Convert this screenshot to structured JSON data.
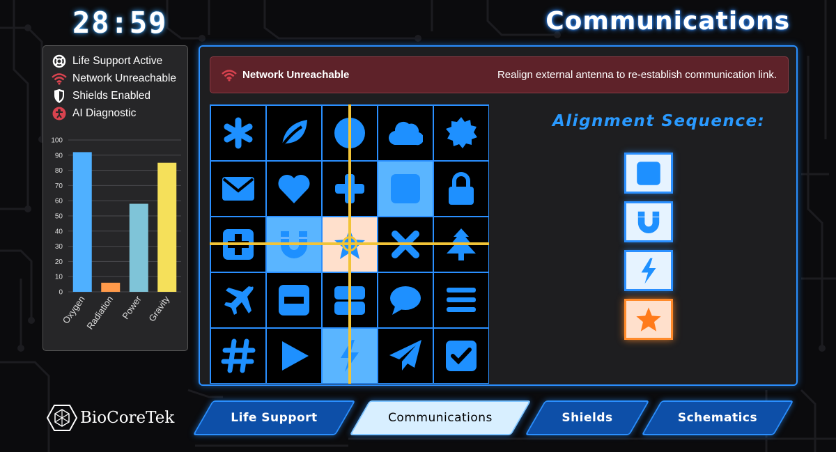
{
  "timer": "28:59",
  "page_title": "Communications",
  "status": {
    "items": [
      {
        "label": "Life Support Active",
        "icon": "life-ring-icon",
        "color": "#ffffff"
      },
      {
        "label": "Network Unreachable",
        "icon": "wifi-icon",
        "color": "#d9434f"
      },
      {
        "label": "Shields Enabled",
        "icon": "shield-icon",
        "color": "#ffffff"
      },
      {
        "label": "AI Diagnostic",
        "icon": "ai-person-icon",
        "color": "#d9434f"
      }
    ]
  },
  "chart_data": {
    "type": "bar",
    "categories": [
      "Oxygen",
      "Radiation",
      "Power",
      "Gravity"
    ],
    "values": [
      92,
      6,
      58,
      85
    ],
    "colors": [
      "#4fb0ff",
      "#ff9a4a",
      "#7fc4d8",
      "#f5e05a"
    ],
    "ylim": [
      0,
      100
    ],
    "yticks": [
      0,
      10,
      20,
      30,
      40,
      50,
      60,
      70,
      80,
      90,
      100
    ],
    "grid": true
  },
  "alert": {
    "title": "Network Unreachable",
    "message": "Realign external antenna to re-establish communication link.",
    "icon": "wifi-icon"
  },
  "grid": {
    "cells": [
      {
        "icon": "asterisk-icon",
        "highlight": ""
      },
      {
        "icon": "leaf-icon",
        "highlight": ""
      },
      {
        "icon": "circle-icon",
        "highlight": ""
      },
      {
        "icon": "cloud-icon",
        "highlight": ""
      },
      {
        "icon": "certificate-icon",
        "highlight": ""
      },
      {
        "icon": "envelope-icon",
        "highlight": ""
      },
      {
        "icon": "heart-icon",
        "highlight": ""
      },
      {
        "icon": "plus-icon",
        "highlight": ""
      },
      {
        "icon": "square-icon",
        "highlight": "blue"
      },
      {
        "icon": "lock-icon",
        "highlight": ""
      },
      {
        "icon": "plus-square-icon",
        "highlight": ""
      },
      {
        "icon": "magnet-icon",
        "highlight": "blue"
      },
      {
        "icon": "star-icon",
        "highlight": "peach"
      },
      {
        "icon": "times-icon",
        "highlight": ""
      },
      {
        "icon": "tree-icon",
        "highlight": ""
      },
      {
        "icon": "plane-icon",
        "highlight": ""
      },
      {
        "icon": "minus-square-icon",
        "highlight": ""
      },
      {
        "icon": "server-icon",
        "highlight": ""
      },
      {
        "icon": "comment-icon",
        "highlight": ""
      },
      {
        "icon": "bars-icon",
        "highlight": ""
      },
      {
        "icon": "hashtag-icon",
        "highlight": ""
      },
      {
        "icon": "play-icon",
        "highlight": ""
      },
      {
        "icon": "bolt-icon",
        "highlight": "blue"
      },
      {
        "icon": "paper-plane-icon",
        "highlight": ""
      },
      {
        "icon": "check-square-icon",
        "highlight": ""
      }
    ]
  },
  "sequence": {
    "title": "Alignment Sequence:",
    "items": [
      {
        "icon": "square-icon",
        "active": false
      },
      {
        "icon": "magnet-icon",
        "active": false
      },
      {
        "icon": "bolt-icon",
        "active": false
      },
      {
        "icon": "star-icon",
        "active": true
      }
    ]
  },
  "logo": {
    "text": "BioCoreTek"
  },
  "tabs": [
    {
      "label": "Life Support",
      "active": false
    },
    {
      "label": "Communications",
      "active": true
    },
    {
      "label": "Shields",
      "active": false
    },
    {
      "label": "Schematics",
      "active": false
    }
  ],
  "colors": {
    "accent": "#2a8fff",
    "alert_bg": "#5e2229",
    "crosshair": "#f2c437",
    "icon_blue": "#1e90ff"
  }
}
